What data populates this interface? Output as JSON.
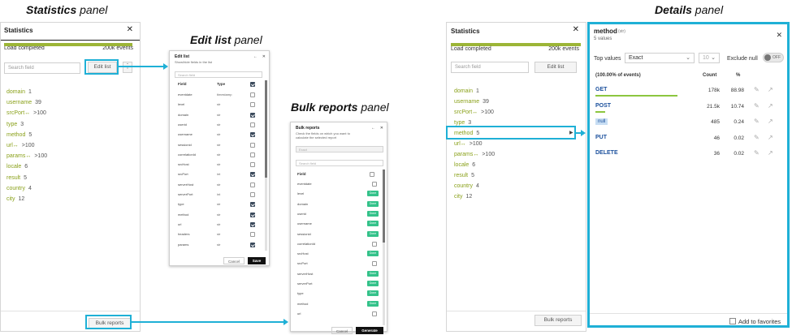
{
  "captions": {
    "statistics": {
      "bold": "Statistics",
      "rest": " panel"
    },
    "editlist": {
      "bold": "Edit list",
      "rest": " panel"
    },
    "bulk": {
      "bold": "Bulk reports",
      "rest": " panel"
    },
    "details": {
      "bold": "Details",
      "rest": " panel"
    }
  },
  "statistics_panel": {
    "title": "Statistics",
    "close": "✕",
    "load_label": "Load completed",
    "load_count": "200k events",
    "progress": 1.0,
    "search_placeholder": "Search field",
    "edit_list_button": "Edit list",
    "more_button": "⋮",
    "fields": [
      {
        "name": "domain",
        "value": "1"
      },
      {
        "name": "username",
        "value": "39"
      },
      {
        "name": "srcPort↔",
        "value": ">100"
      },
      {
        "name": "type",
        "value": "3"
      },
      {
        "name": "method",
        "value": "5"
      },
      {
        "name": "url↔",
        "value": ">100"
      },
      {
        "name": "params↔",
        "value": ">100"
      },
      {
        "name": "locale",
        "value": "6"
      },
      {
        "name": "result",
        "value": "5"
      },
      {
        "name": "country",
        "value": "4"
      },
      {
        "name": "city",
        "value": "12"
      }
    ],
    "bulk_reports_button": "Bulk reports"
  },
  "edit_list": {
    "title": "Edit list",
    "subtitle": "Show/hide fields in the list",
    "back": "←",
    "close": "✕",
    "search_placeholder": "Search field",
    "col_field": "Field",
    "col_type": "Type",
    "rows": [
      {
        "field": "eventdate",
        "type": "timestamp",
        "checked": false
      },
      {
        "field": "level",
        "type": "str",
        "checked": false
      },
      {
        "field": "domain",
        "type": "str",
        "checked": true
      },
      {
        "field": "userid",
        "type": "str",
        "checked": false
      },
      {
        "field": "username",
        "type": "str",
        "checked": true
      },
      {
        "field": "sessionid",
        "type": "str",
        "checked": false
      },
      {
        "field": "correlationId",
        "type": "str",
        "checked": false
      },
      {
        "field": "srcHost",
        "type": "str",
        "checked": false
      },
      {
        "field": "srcPort",
        "type": "int",
        "checked": true
      },
      {
        "field": "serverHost",
        "type": "str",
        "checked": false
      },
      {
        "field": "serverPort",
        "type": "int",
        "checked": false
      },
      {
        "field": "type",
        "type": "str",
        "checked": true
      },
      {
        "field": "method",
        "type": "str",
        "checked": true
      },
      {
        "field": "url",
        "type": "str",
        "checked": true
      },
      {
        "field": "headers",
        "type": "str",
        "checked": false
      },
      {
        "field": "params",
        "type": "str",
        "checked": true
      }
    ],
    "cancel": "Cancel",
    "save": "Save"
  },
  "bulk_reports": {
    "title": "Bulk reports",
    "subtitle": "Check the fields on which you want to calculate the selected report",
    "back": "←",
    "close": "✕",
    "select_value": "Exact",
    "search_placeholder": "Search field",
    "col_field": "Field",
    "done_label": "Done",
    "rows": [
      {
        "field": "eventdate",
        "done": false
      },
      {
        "field": "level",
        "done": true
      },
      {
        "field": "domain",
        "done": true
      },
      {
        "field": "userid",
        "done": true
      },
      {
        "field": "username",
        "done": true
      },
      {
        "field": "sessionid",
        "done": true
      },
      {
        "field": "correlationId",
        "done": false
      },
      {
        "field": "srcHost",
        "done": true
      },
      {
        "field": "srcPort",
        "done": false
      },
      {
        "field": "serverHost",
        "done": true
      },
      {
        "field": "serverPort",
        "done": true
      },
      {
        "field": "type",
        "done": true
      },
      {
        "field": "method",
        "done": true
      },
      {
        "field": "url",
        "done": false
      }
    ],
    "cancel": "Cancel",
    "generate": "Generate"
  },
  "details_panel": {
    "title": "method",
    "type": "(str)",
    "subtitle": "5 values",
    "close": "✕",
    "top_values_label": "Top values",
    "select_value": "Exact",
    "select_count": "10",
    "exclude_null": "Exclude null",
    "toggle_off": "OFF",
    "header_events": "(100.00% of events)",
    "header_count": "Count",
    "header_pct": "%",
    "rows": [
      {
        "value": "GET",
        "count": "178k",
        "pct": "88.98",
        "ratio": 0.8898,
        "is_null": false
      },
      {
        "value": "POST",
        "count": "21.5k",
        "pct": "10.74",
        "ratio": 0.1074,
        "is_null": false
      },
      {
        "value": "null",
        "count": "485",
        "pct": "0.24",
        "ratio": 0.0024,
        "is_null": true
      },
      {
        "value": "PUT",
        "count": "46",
        "pct": "0.02",
        "ratio": 0.0002,
        "is_null": false
      },
      {
        "value": "DELETE",
        "count": "36",
        "pct": "0.02",
        "ratio": 0.0002,
        "is_null": false
      }
    ],
    "add_favorites": "Add to favorites"
  },
  "colors": {
    "accent": "#1fb0d6",
    "field_green": "#8aa11a",
    "progress": "#9cb537",
    "done_badge": "#34c28a",
    "link_blue": "#1a4f9c"
  }
}
